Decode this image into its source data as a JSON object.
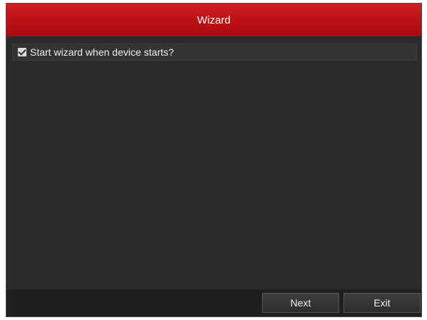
{
  "dialog": {
    "title": "Wizard",
    "option": {
      "label": "Start wizard when device starts?",
      "checked": true,
      "icon": "checkmark-icon"
    },
    "buttons": {
      "next_label": "Next",
      "exit_label": "Exit"
    }
  },
  "colors": {
    "title_bar": "#bc1015",
    "dialog_background": "#2b2b2b",
    "footer_background": "#1f1f1f",
    "text": "#ededed"
  }
}
